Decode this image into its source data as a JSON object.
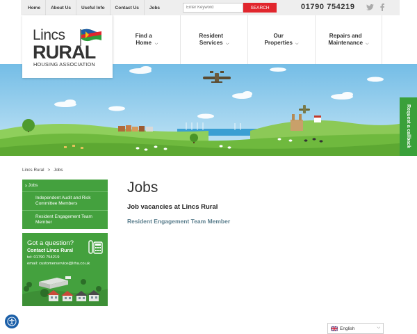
{
  "topbar": {
    "nav": [
      "Home",
      "About Us",
      "Useful Info",
      "Contact Us",
      "Jobs"
    ],
    "search_placeholder": "Enter Keyword",
    "search_button": "SEARCH",
    "phone": "01790 754219"
  },
  "logo": {
    "line1": "Lincs",
    "line2": "RURAL",
    "line3": "HOUSING ASSOCIATION"
  },
  "mainnav": [
    {
      "label": "Find a\nHome"
    },
    {
      "label": "Resident\nServices"
    },
    {
      "label": "Our\nProperties"
    },
    {
      "label": "Repairs and\nMaintenance"
    }
  ],
  "callback": "Request a callback",
  "breadcrumb": {
    "home": "Lincs Rural",
    "sep": ">",
    "current": "Jobs"
  },
  "sidebar": {
    "active": "Jobs",
    "items": [
      "Independent Audit and Risk Committee Members",
      "Resident Engagement Team Member"
    ]
  },
  "question": {
    "title": "Got a question?",
    "contact": "Contact Lincs Rural",
    "tel": "tel: 01790 754219",
    "email": "email: customerservice@lrha.co.uk"
  },
  "main": {
    "title": "Jobs",
    "subtitle": "Job vacancies at Lincs Rural",
    "link": "Resident Engagement Team Member"
  },
  "language": "English",
  "colors": {
    "brand_green": "#44a13e",
    "accent_red": "#e1262d",
    "link": "#5c7f8e"
  }
}
